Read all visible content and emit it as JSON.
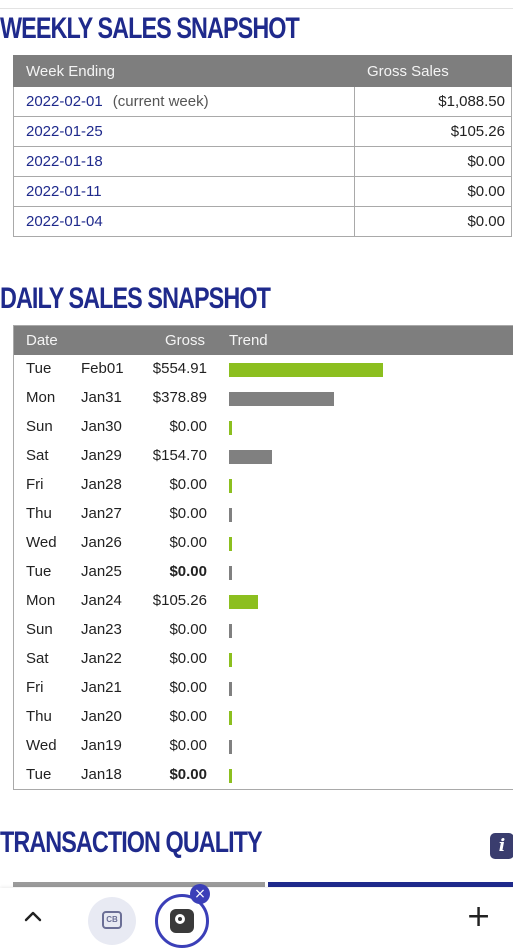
{
  "weekly": {
    "title": "WEEKLY SALES SNAPSHOT",
    "headers": [
      "Week Ending",
      "Gross Sales"
    ],
    "rows": [
      {
        "week": "2022-02-01",
        "note": "(current week)",
        "gross": "$1,088.50"
      },
      {
        "week": "2022-01-25",
        "note": "",
        "gross": "$105.26"
      },
      {
        "week": "2022-01-18",
        "note": "",
        "gross": "$0.00"
      },
      {
        "week": "2022-01-11",
        "note": "",
        "gross": "$0.00"
      },
      {
        "week": "2022-01-04",
        "note": "",
        "gross": "$0.00"
      }
    ]
  },
  "daily": {
    "title": "DAILY SALES SNAPSHOT",
    "headers": {
      "date": "Date",
      "gross": "Gross",
      "trend": "Trend"
    },
    "rows": [
      {
        "day": "Tue",
        "date": "Feb01",
        "gross": "$554.91",
        "amount": 554.91,
        "bold": false,
        "color": "green"
      },
      {
        "day": "Mon",
        "date": "Jan31",
        "gross": "$378.89",
        "amount": 378.89,
        "bold": false,
        "color": "gray"
      },
      {
        "day": "Sun",
        "date": "Jan30",
        "gross": "$0.00",
        "amount": 0,
        "bold": false,
        "color": "green"
      },
      {
        "day": "Sat",
        "date": "Jan29",
        "gross": "$154.70",
        "amount": 154.7,
        "bold": false,
        "color": "gray"
      },
      {
        "day": "Fri",
        "date": "Jan28",
        "gross": "$0.00",
        "amount": 0,
        "bold": false,
        "color": "green"
      },
      {
        "day": "Thu",
        "date": "Jan27",
        "gross": "$0.00",
        "amount": 0,
        "bold": false,
        "color": "gray"
      },
      {
        "day": "Wed",
        "date": "Jan26",
        "gross": "$0.00",
        "amount": 0,
        "bold": false,
        "color": "green"
      },
      {
        "day": "Tue",
        "date": "Jan25",
        "gross": "$0.00",
        "amount": 0,
        "bold": true,
        "color": "gray"
      },
      {
        "day": "Mon",
        "date": "Jan24",
        "gross": "$105.26",
        "amount": 105.26,
        "bold": false,
        "color": "green"
      },
      {
        "day": "Sun",
        "date": "Jan23",
        "gross": "$0.00",
        "amount": 0,
        "bold": false,
        "color": "gray"
      },
      {
        "day": "Sat",
        "date": "Jan22",
        "gross": "$0.00",
        "amount": 0,
        "bold": false,
        "color": "green"
      },
      {
        "day": "Fri",
        "date": "Jan21",
        "gross": "$0.00",
        "amount": 0,
        "bold": false,
        "color": "gray"
      },
      {
        "day": "Thu",
        "date": "Jan20",
        "gross": "$0.00",
        "amount": 0,
        "bold": false,
        "color": "green"
      },
      {
        "day": "Wed",
        "date": "Jan19",
        "gross": "$0.00",
        "amount": 0,
        "bold": false,
        "color": "gray"
      },
      {
        "day": "Tue",
        "date": "Jan18",
        "gross": "$0.00",
        "amount": 0,
        "bold": true,
        "color": "green"
      }
    ]
  },
  "transaction_quality": {
    "title": "TRANSACTION QUALITY",
    "info_icon": "info-icon"
  },
  "toolbar": {
    "up_icon": "chevron-up-icon",
    "tab_label": "CB",
    "close_glyph": "×",
    "plus_glyph": "+"
  },
  "colors": {
    "title": "#1f2a8c",
    "header_bg": "#7e7e7e",
    "bar_green": "#8cbf1f",
    "bar_gray": "#808080",
    "accent": "#3b3fb8"
  }
}
